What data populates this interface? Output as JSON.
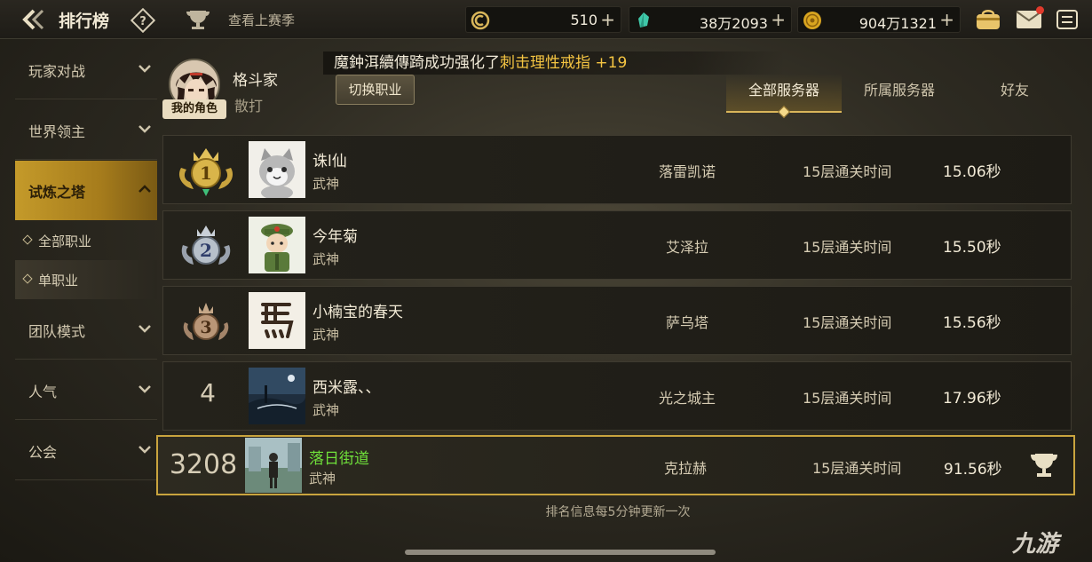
{
  "header": {
    "title": "排行榜",
    "prev_season": "查看上赛季",
    "currencies": [
      {
        "icon": "crystal-coin-icon",
        "value": "510"
      },
      {
        "icon": "gem-icon",
        "value": "38万2093"
      },
      {
        "icon": "gold-coin-icon",
        "value": "904万1321"
      }
    ],
    "plus": "+"
  },
  "sidebar": {
    "items": [
      {
        "label": "玩家对战"
      },
      {
        "label": "世界领主"
      },
      {
        "label": "试炼之塔"
      },
      {
        "label": "团队模式"
      },
      {
        "label": "人气"
      },
      {
        "label": "公会"
      }
    ],
    "subitems": [
      {
        "label": "全部职业"
      },
      {
        "label": "单职业"
      }
    ]
  },
  "player": {
    "name": "格斗家",
    "class": "散打",
    "badge": "我的角色",
    "switch_label": "切换职业"
  },
  "announcement": {
    "prefix": "魔鈡洱續傳踦成功强化了",
    "item": "刺击理性戒指 +19"
  },
  "tabs": [
    {
      "label": "全部服务器"
    },
    {
      "label": "所属服务器"
    },
    {
      "label": "好友"
    }
  ],
  "rows": [
    {
      "rank": "1",
      "name": "诛l仙",
      "class": "武神",
      "server": "落雷凯诺",
      "floor": "15层通关时间",
      "time": "15.06秒"
    },
    {
      "rank": "2",
      "name": "今年菊",
      "class": "武神",
      "server": "艾泽拉",
      "floor": "15层通关时间",
      "time": "15.50秒"
    },
    {
      "rank": "3",
      "name": "小楠宝的春天",
      "class": "武神",
      "server": "萨乌塔",
      "floor": "15层通关时间",
      "time": "15.56秒"
    },
    {
      "rank": "4",
      "name": "西米露、、",
      "class": "武神",
      "server": "光之城主",
      "floor": "15层通关时间",
      "time": "17.96秒"
    }
  ],
  "self_row": {
    "rank": "3208",
    "name": "落日街道",
    "class": "武神",
    "server": "克拉赫",
    "floor": "15层通关时间",
    "time": "91.56秒"
  },
  "footer": "排名信息每5分钟更新一次",
  "watermark": "九游",
  "colors": {
    "accent": "#c9a43e",
    "highlight": "#f5c542",
    "self_name": "#6fe03a"
  }
}
